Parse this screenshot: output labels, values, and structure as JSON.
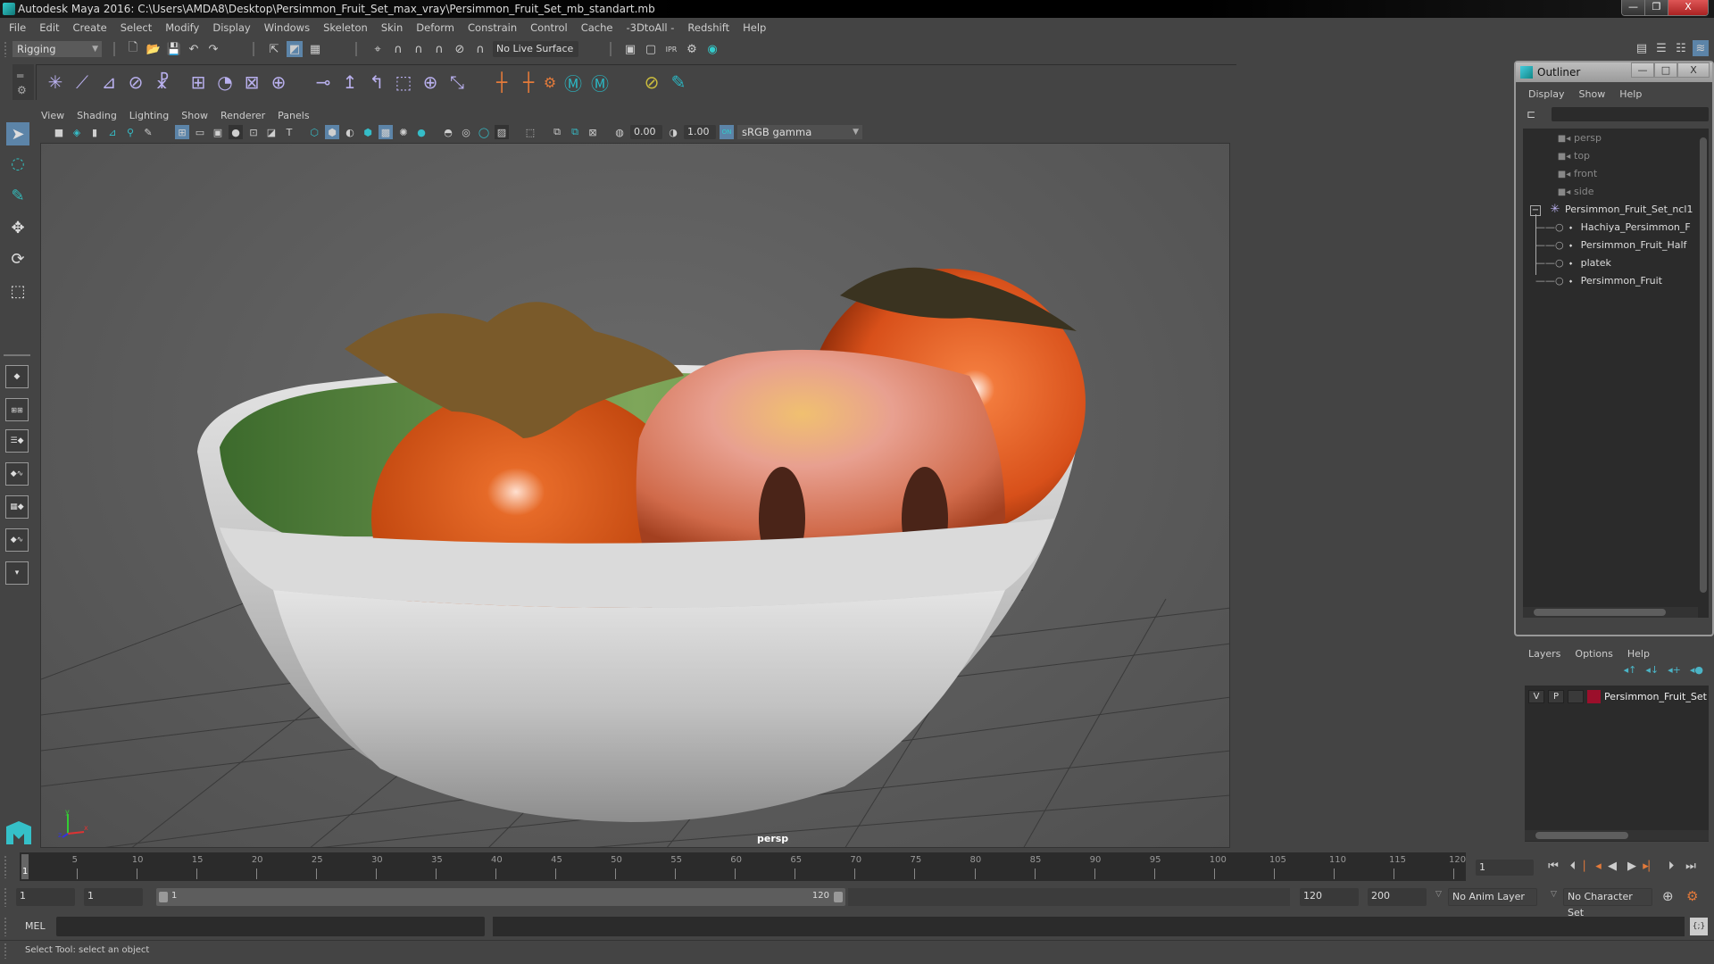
{
  "window": {
    "title": "Autodesk Maya 2016: C:\\Users\\AMDA8\\Desktop\\Persimmon_Fruit_Set_max_vray\\Persimmon_Fruit_Set_mb_standart.mb",
    "minimize": "—",
    "restore": "❐",
    "close": "X"
  },
  "menubar": [
    "File",
    "Edit",
    "Create",
    "Select",
    "Modify",
    "Display",
    "Windows",
    "Skeleton",
    "Skin",
    "Deform",
    "Constrain",
    "Control",
    "Cache",
    "-3DtoAll -",
    "Redshift",
    "Help"
  ],
  "status_line": {
    "menuset": "Rigging",
    "live_surface": "No Live Surface",
    "icons": [
      "new-scene-icon",
      "open-scene-icon",
      "save-scene-icon",
      "undo-icon",
      "redo-icon",
      "select-hierarchy-icon",
      "select-object-icon",
      "select-component-icon",
      "snap-grid-icon",
      "snap-curve-icon",
      "snap-point-icon",
      "snap-view-plane-icon",
      "snap-live-icon",
      "make-live-icon",
      "render-view-icon",
      "render-frame-icon",
      "ipr-render-icon",
      "render-settings-icon",
      "hypershade-icon"
    ]
  },
  "shelf": {
    "icons": [
      "joint-tool-icon",
      "ik-handle-icon",
      "ik-spline-icon",
      "insert-joint-icon",
      "humanik-icon",
      "bind-skin-icon",
      "paint-weights-icon",
      "lattice-icon",
      "cluster-icon",
      "parent-constraint-icon",
      "point-constraint-icon",
      "orient-constraint-icon",
      "scale-constraint-icon",
      "aim-constraint-icon",
      "pole-vector-icon",
      "locator-icon",
      "ik-fk-icon",
      "character-icon",
      "maya-icon-1",
      "maya-icon-2",
      "blend-icon",
      "quick-select-icon"
    ]
  },
  "toolbox": {
    "tools": [
      "select-tool-icon",
      "lasso-tool-icon",
      "paint-select-icon",
      "move-tool-icon",
      "rotate-tool-icon",
      "scale-tool-icon"
    ],
    "layouts": [
      "single-view-layout",
      "four-view-layout",
      "outliner-persp-layout",
      "graph-persp-layout",
      "hypershade-layout",
      "trax-layout"
    ]
  },
  "panel": {
    "menus": [
      "View",
      "Shading",
      "Lighting",
      "Show",
      "Renderer",
      "Panels"
    ],
    "exposure": "0.00",
    "gamma": "1.00",
    "color_space": "sRGB gamma",
    "camera_label": "persp",
    "color_mgmt_badge": "ON"
  },
  "outliner": {
    "title": "Outliner",
    "menus": [
      "Display",
      "Show",
      "Help"
    ],
    "items": [
      {
        "label": "persp",
        "type": "camera"
      },
      {
        "label": "top",
        "type": "camera"
      },
      {
        "label": "front",
        "type": "camera"
      },
      {
        "label": "side",
        "type": "camera"
      },
      {
        "label": "Persimmon_Fruit_Set_ncl1",
        "type": "group"
      },
      {
        "label": "Hachiya_Persimmon_F",
        "type": "mesh"
      },
      {
        "label": "Persimmon_Fruit_Half",
        "type": "mesh"
      },
      {
        "label": "platek",
        "type": "mesh"
      },
      {
        "label": "Persimmon_Fruit",
        "type": "mesh"
      }
    ]
  },
  "layers": {
    "menus": [
      "Layers",
      "Options",
      "Help"
    ],
    "rows": [
      {
        "v": "V",
        "p": "P",
        "name": "Persimmon_Fruit_Set",
        "color": "#9b0f2b"
      }
    ]
  },
  "timeline": {
    "ticks": [
      5,
      10,
      15,
      20,
      25,
      30,
      35,
      40,
      45,
      50,
      55,
      60,
      65,
      70,
      75,
      80,
      85,
      90,
      95,
      100,
      105,
      110,
      115,
      120
    ],
    "start": 1,
    "end": 120,
    "current_frame": "1",
    "current_frame_field": "1"
  },
  "range": {
    "start": "1",
    "playback_start": "1",
    "slider_start": "1",
    "slider_end": "120",
    "playback_end": "120",
    "end": "200",
    "anim_layer": "No Anim Layer",
    "character_set": "No Character Set"
  },
  "mel": {
    "label": "MEL"
  },
  "status": {
    "help_line": "Select Tool: select an object"
  },
  "colors": {
    "accent": "#5c84a8",
    "teal": "#2bb6c2",
    "layer_color": "#9b0f2b",
    "playback_orange": "#e47a3a"
  }
}
